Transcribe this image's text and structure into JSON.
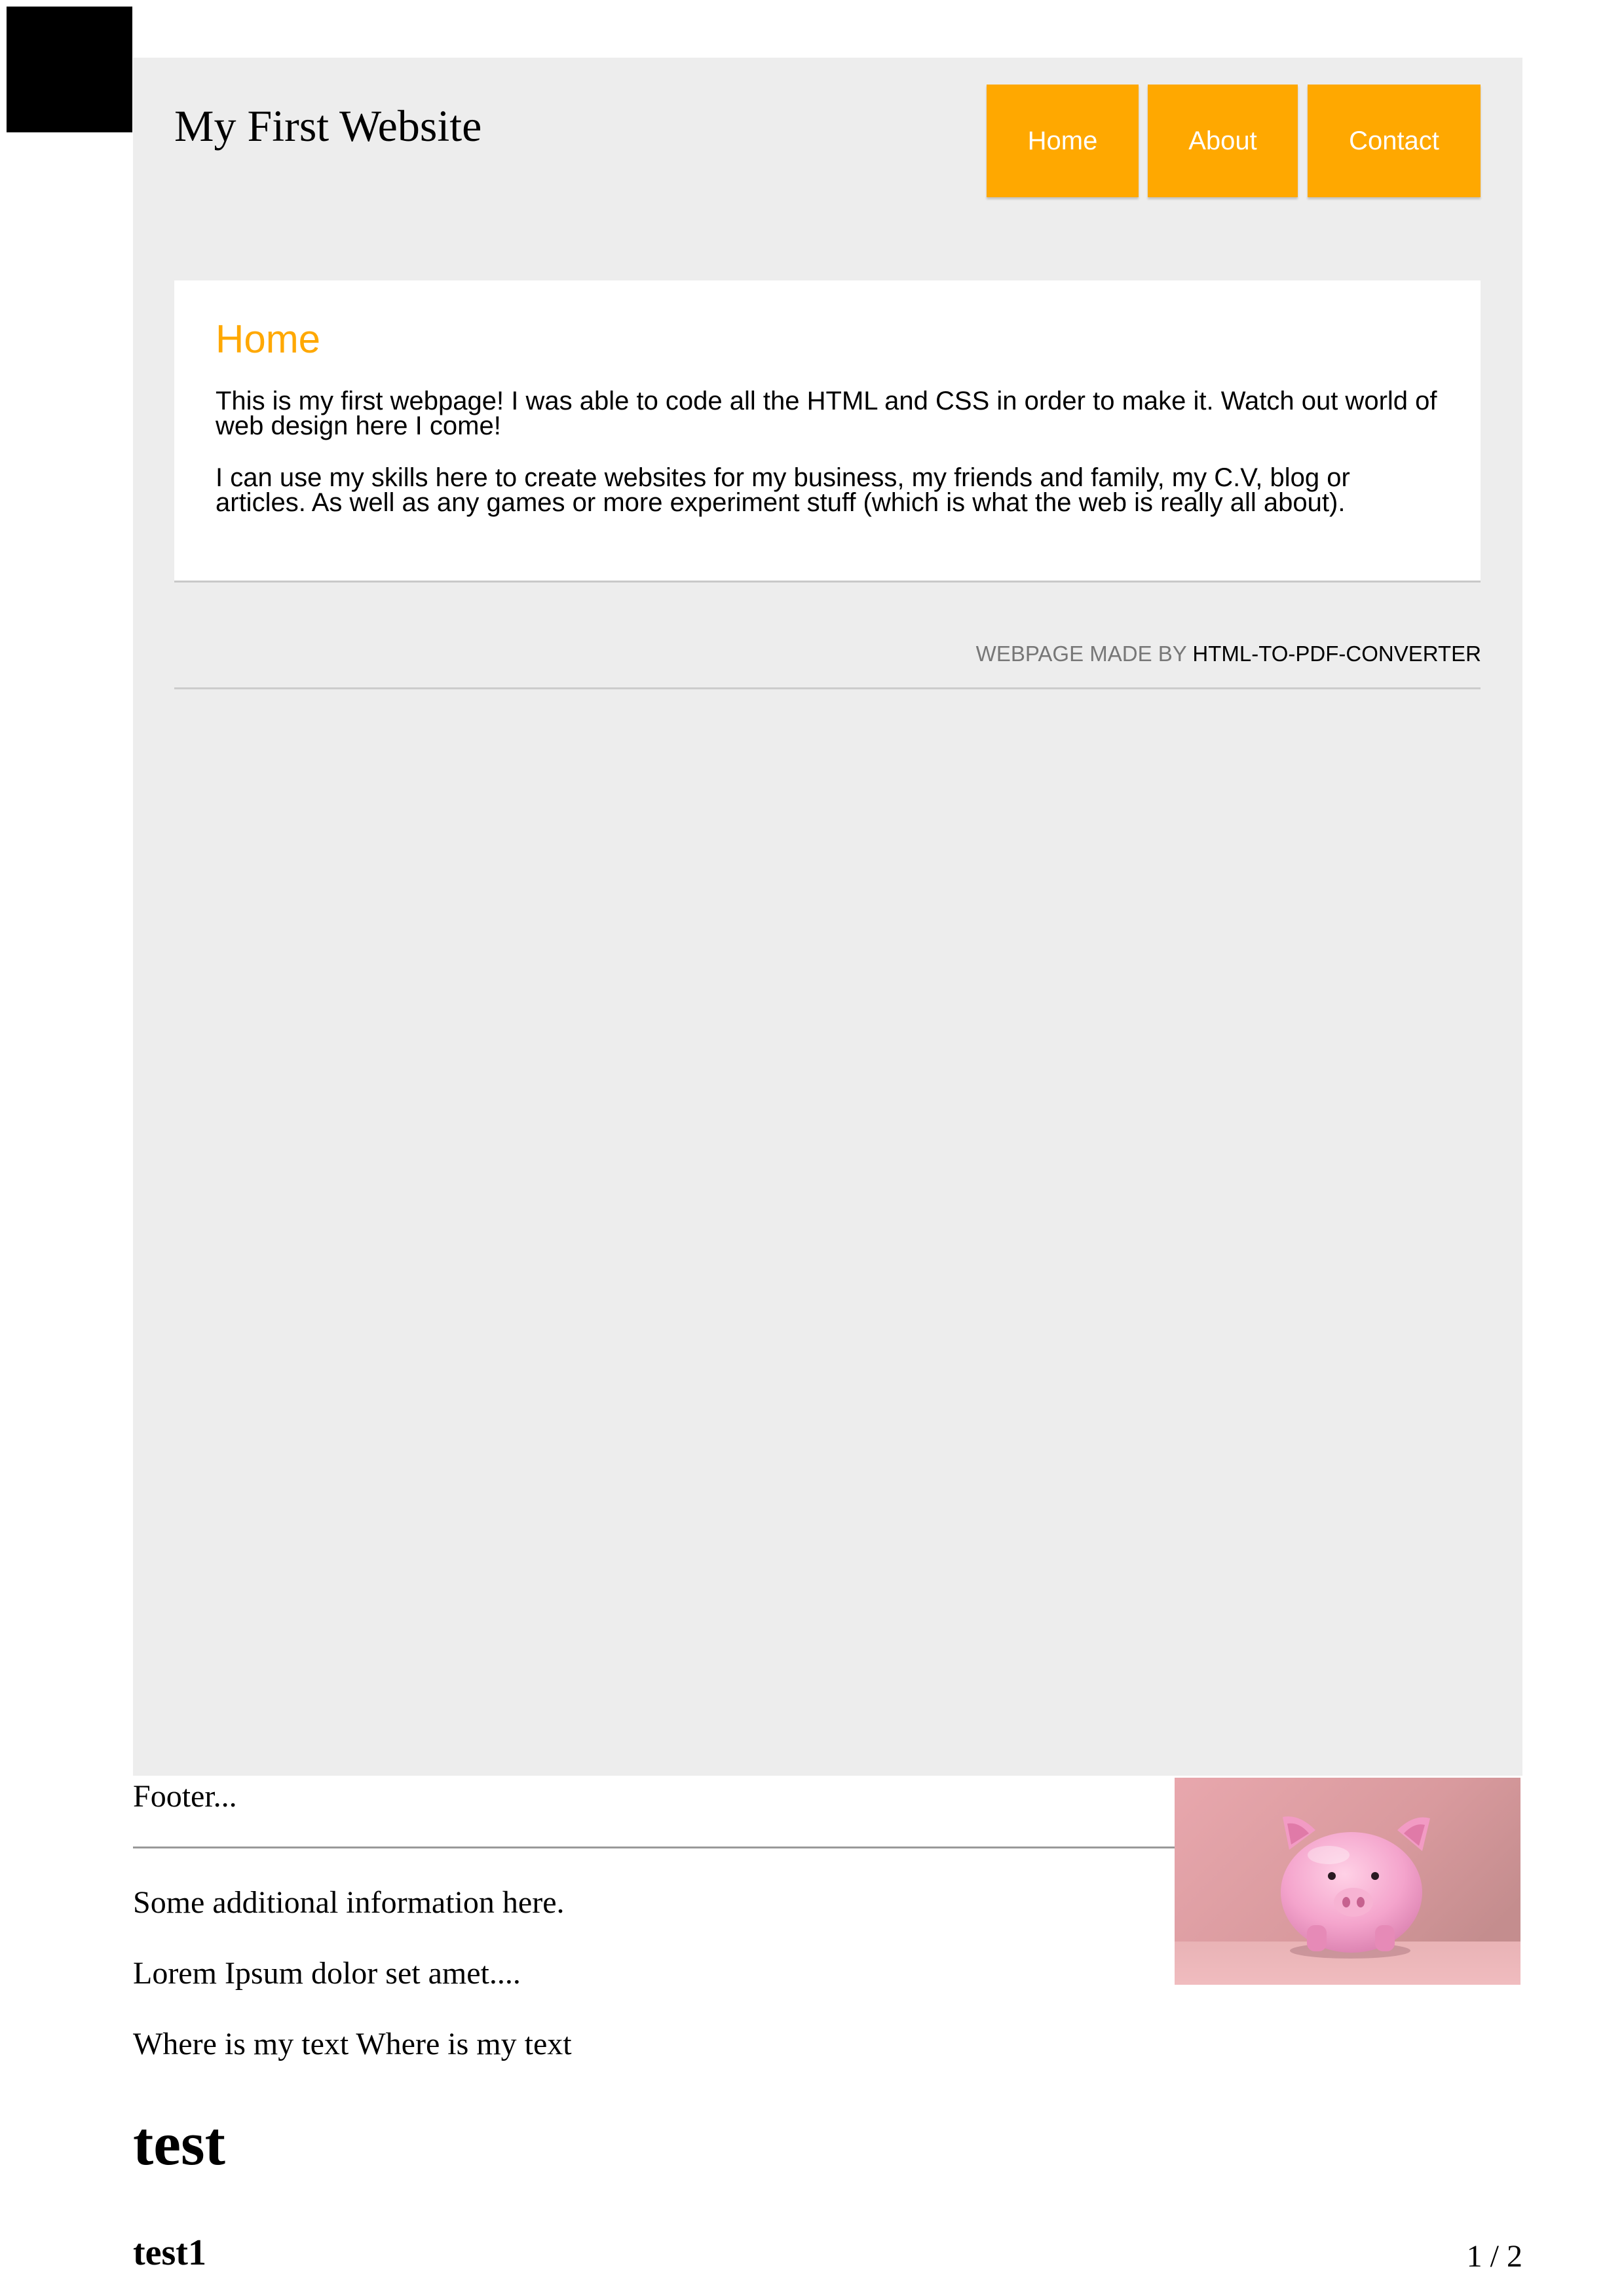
{
  "header": {
    "site_title": "My First Website",
    "nav": [
      {
        "label": "Home"
      },
      {
        "label": "About"
      },
      {
        "label": "Contact"
      }
    ]
  },
  "main": {
    "heading": "Home",
    "paragraphs": [
      "This is my first webpage! I was able to code all the HTML and CSS in order to make it. Watch out world of web design here I come!",
      "I can use my skills here to create websites for my business, my friends and family, my C.V, blog or articles. As well as any games or more experiment stuff (which is what the web is really all about)."
    ]
  },
  "credit": {
    "prefix": "WEBPAGE MADE BY",
    "link": "HTML-TO-PDF-CONVERTER"
  },
  "footer": {
    "label": "Footer...",
    "lines": [
      "Some additional information here.",
      "Lorem Ipsum dolor set amet....",
      "Where is my text Where is my text"
    ],
    "image": "piggy-bank-image"
  },
  "headings": {
    "test": "test",
    "test1": "test1"
  },
  "page_number": "1 / 2",
  "colors": {
    "accent": "#ffa800",
    "page_background": "#ededed",
    "card_background": "#ffffff",
    "credit_text": "#777777"
  }
}
